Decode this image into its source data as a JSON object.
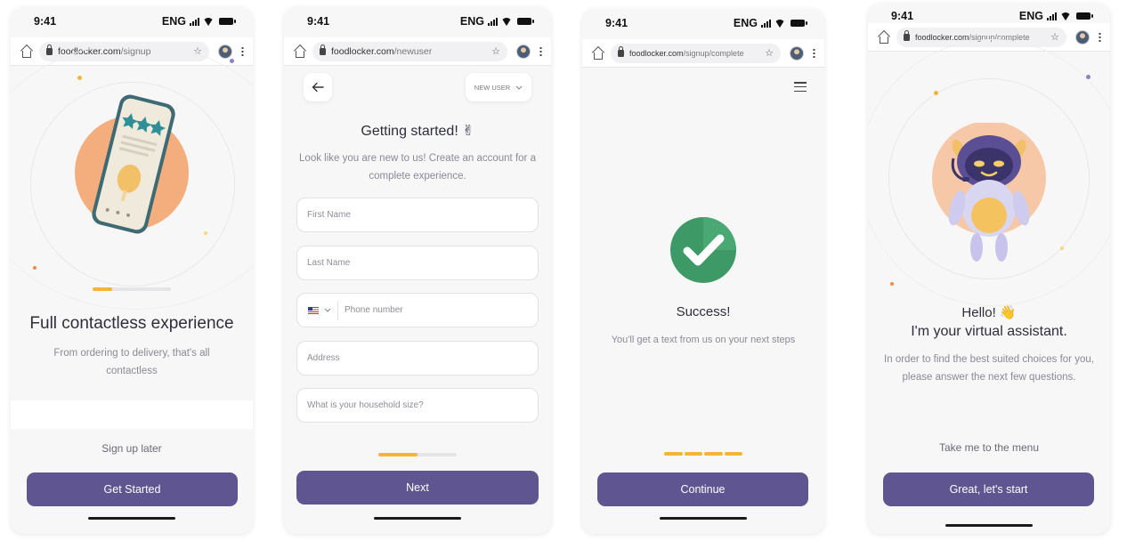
{
  "common": {
    "time": "9:41",
    "lang": "ENG"
  },
  "screens": [
    {
      "url_domain": "foodlocker.com",
      "url_path": "/signup",
      "progress": 0.25,
      "title": "Full contactless experience",
      "subtitle": "From ordering to delivery, that's all contactless",
      "link": "Sign up later",
      "button": "Get Started",
      "colors": {
        "circle": "#f4ae7e",
        "phone_body": "#3e6a74"
      }
    },
    {
      "url_domain": "foodlocker.com",
      "url_path": "/newuser",
      "back_icon": "arrow-left-icon",
      "user_type": "NEW USER",
      "title": "Getting started! ✌",
      "subtitle": "Look like you are new to us! Create an account for a complete experience.",
      "fields": {
        "first_name": "First Name",
        "last_name": "Last Name",
        "phone": "Phone number",
        "address": "Address",
        "household": "What is your household size?"
      },
      "progress": 0.5,
      "button": "Next"
    },
    {
      "url_domain": "foodlocker.com",
      "url_path": "/signup/complete",
      "menu_icon": "hamburger-menu-icon",
      "title": "Success!",
      "subtitle": "You'll get a text from us on your next steps",
      "progress": 1,
      "button": "Continue",
      "colors": {
        "check": "#3d9a66"
      }
    },
    {
      "url_domain": "foodlocker.com",
      "url_path": "/signup/complete",
      "title_line1": "Hello! 👋",
      "title_line2": "I'm your virtual assistant.",
      "subtitle": "In order to find the best suited choices for you, please answer the next few questions.",
      "link": "Take me to the menu",
      "button": "Great, let's start",
      "colors": {
        "circle": "#f6c8a8",
        "robot": "#5a4f94"
      }
    }
  ],
  "colors": {
    "primary": "#5f5590",
    "accent": "#f1b635"
  }
}
